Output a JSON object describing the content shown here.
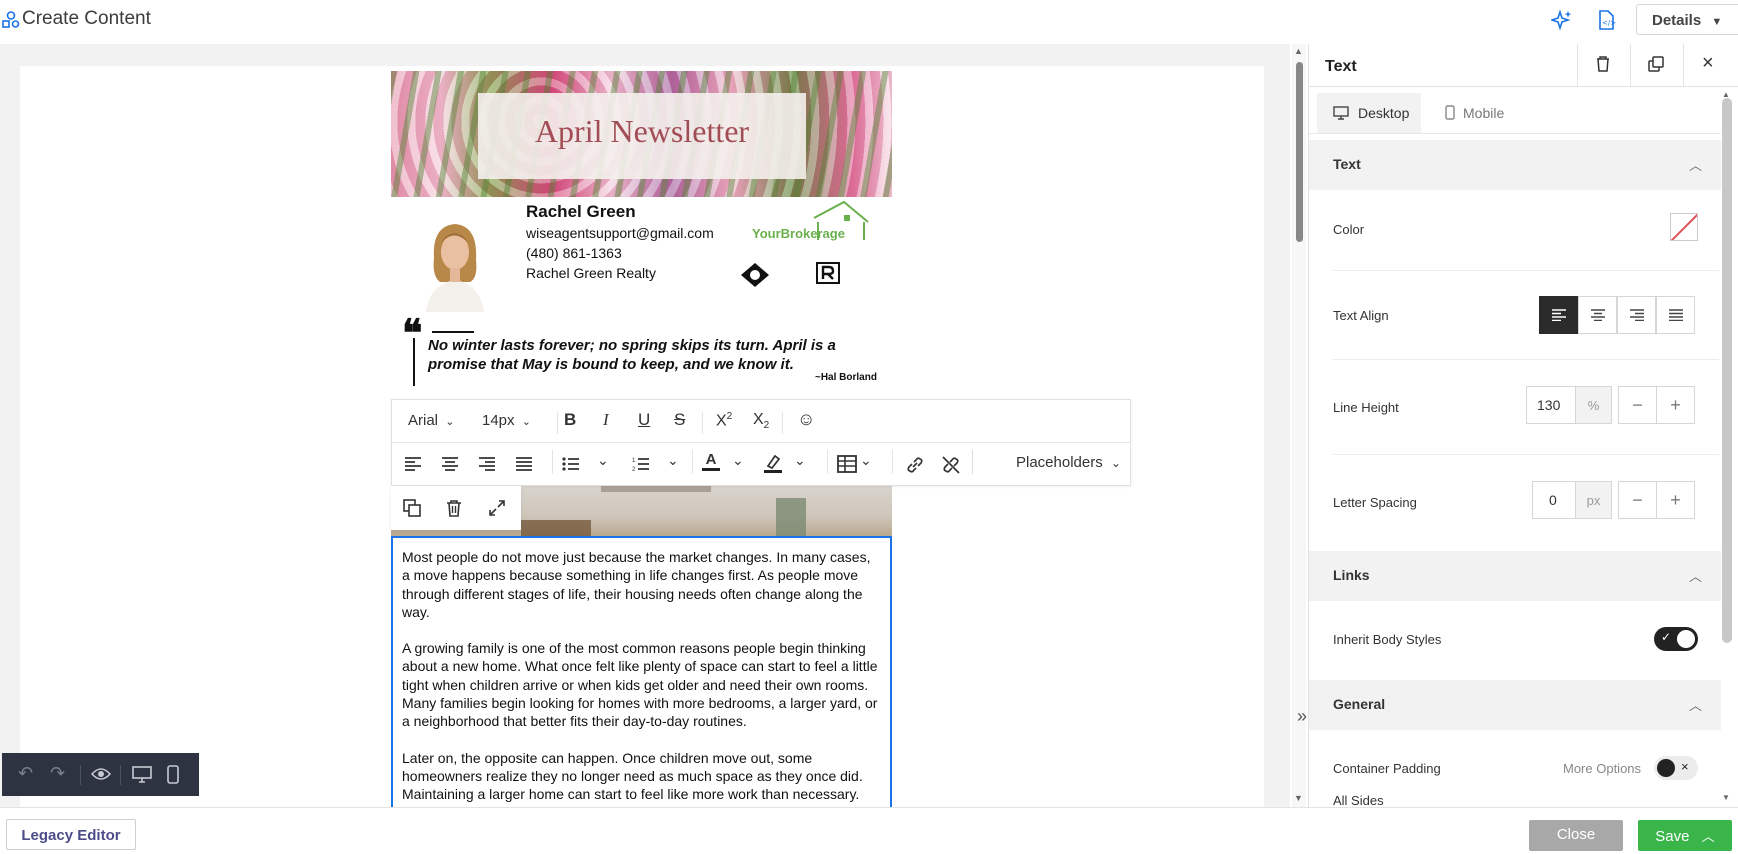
{
  "header": {
    "title": "Create Content",
    "details_label": "Details"
  },
  "email": {
    "banner_title": "April Newsletter",
    "agent": {
      "name": "Rachel Green",
      "email": "wiseagentsupport@gmail.com",
      "phone": "(480) 861-1363",
      "company": "Rachel Green Realty"
    },
    "brokerage_logo_text": "YourBrokerage",
    "quote": "No winter lasts forever; no spring skips its turn. April is a promise that May is bound to keep, and we know it.",
    "quote_author": "~Hal Borland",
    "body_paragraphs": [
      "Most people do not move just because the market changes. In many cases, a move happens because something in life changes first. As people move through different stages of life, their housing needs often change along the way.",
      "A growing family is one of the most common reasons people begin thinking about a new home. What once felt like plenty of space can start to feel a little tight when children arrive or when kids get older and need their own rooms. Many families begin looking for homes with more bedrooms, a larger yard, or a neighborhood that better fits their day-to-day routines.",
      "Later on, the opposite can happen. Once children move out, some homeowners realize they no longer need as much space as they once did. Maintaining a larger home can start to feel like more work than necessary. Downsizing to a smaller home, a condo, or a property with less maintenance"
    ]
  },
  "toolbar": {
    "font_family": "Arial",
    "font_size": "14px",
    "placeholders_label": "Placeholders"
  },
  "panel": {
    "title": "Text",
    "tabs": {
      "desktop": "Desktop",
      "mobile": "Mobile"
    },
    "sections": {
      "text": "Text",
      "links": "Links",
      "general": "General"
    },
    "labels": {
      "color": "Color",
      "text_align": "Text Align",
      "line_height": "Line Height",
      "letter_spacing": "Letter Spacing",
      "inherit_body_styles": "Inherit Body Styles",
      "container_padding": "Container Padding",
      "more_options": "More Options",
      "all_sides": "All Sides"
    },
    "line_height_value": "130",
    "line_height_unit": "%",
    "letter_spacing_value": "0",
    "letter_spacing_unit": "px",
    "inherit_body_styles_on": true,
    "container_padding_on": false
  },
  "footer": {
    "legacy_label": "Legacy Editor",
    "close_label": "Close",
    "save_label": "Save"
  },
  "colors": {
    "accent_blue": "#1a73e8",
    "save_green": "#3ab54a",
    "close_gray": "#a8a8a8",
    "toolbar_dark": "#2d3340"
  }
}
